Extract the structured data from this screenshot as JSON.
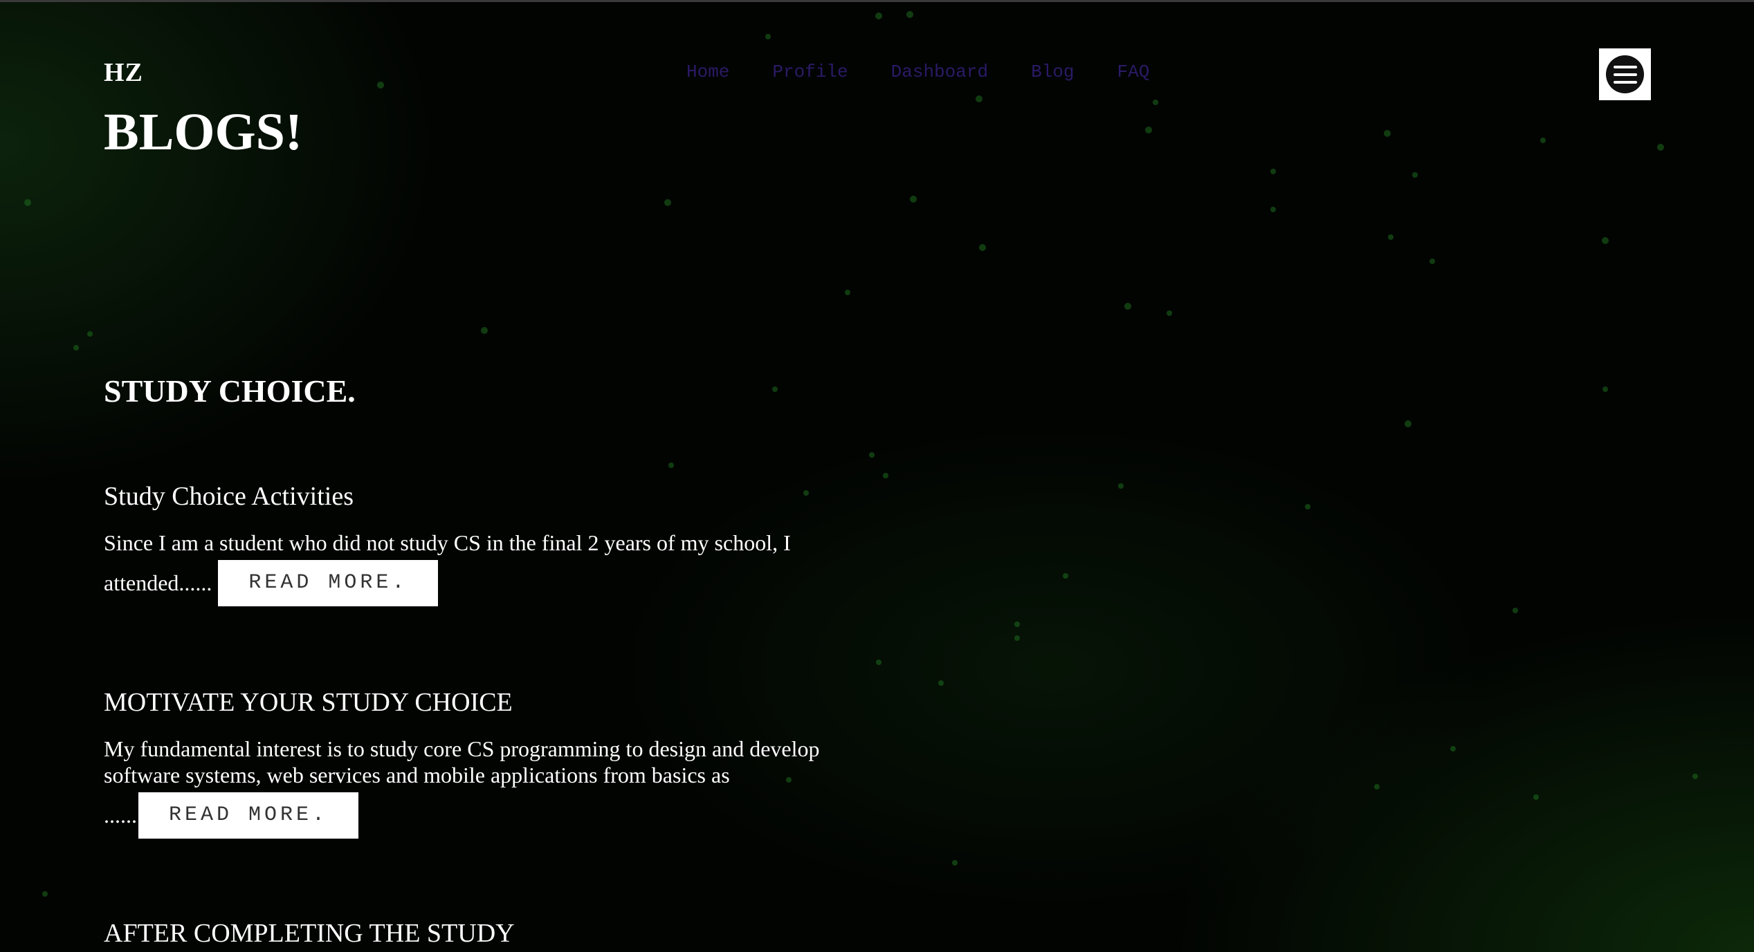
{
  "header": {
    "logo": "HZ",
    "nav": [
      "Home",
      "Profile",
      "Dashboard",
      "Blog",
      "FAQ"
    ],
    "menu_icon": "hamburger-menu-icon"
  },
  "page": {
    "title": "BLOGS!",
    "section_heading": "STUDY CHOICE."
  },
  "posts": [
    {
      "title": "Study Choice Activities",
      "excerpt": "Since I am a student who did not study CS in the final 2 years of my school, I",
      "excerpt_tail": "attended......",
      "button": "READ MORE."
    },
    {
      "title": "MOTIVATE YOUR STUDY CHOICE",
      "excerpt": "My fundamental interest is to study core CS programming to design and develop software systems, web services and mobile applications from basics as",
      "excerpt_tail": "......",
      "button": "READ MORE."
    },
    {
      "title": "AFTER COMPLETING THE STUDY"
    }
  ],
  "colors": {
    "background": "#020402",
    "nav_link": "#2b1a66",
    "text": "#ffffff",
    "button_bg": "#ffffff",
    "button_text": "#333333"
  }
}
